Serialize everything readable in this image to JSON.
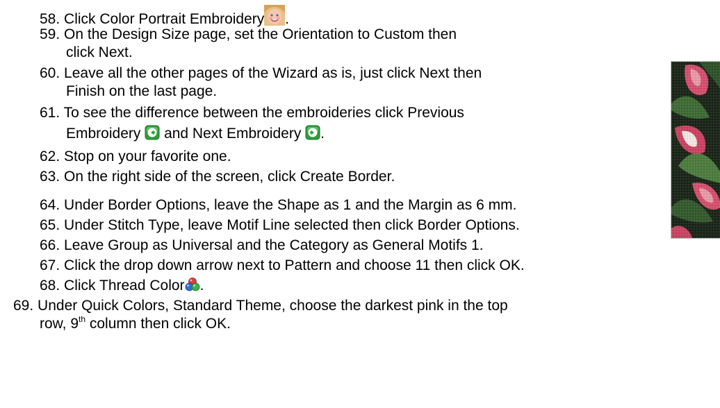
{
  "steps": [
    {
      "num": "58.",
      "pre": "Click Color Portrait Embroidery",
      "post": ".",
      "icon": "child-face-icon"
    },
    {
      "num": "59.",
      "line1": "On the Design Size page, set the Orientation to Custom then",
      "line2": "click Next."
    },
    {
      "num": "60.",
      "line1": "Leave all the other pages of the Wizard as is, just click Next then",
      "line2": "Finish on the last page."
    },
    {
      "num": "61.",
      "line1": "To see the difference between the embroideries click Previous",
      "line2_a": "Embroidery",
      "line2_b": "and Next Embroidery",
      "line2_c": ".",
      "icon_prev": "previous-embroidery-icon",
      "icon_next": "next-embroidery-icon"
    },
    {
      "num": "62.",
      "text": "Stop on your favorite one."
    },
    {
      "num": "63.",
      "text": "On the right side of the screen, click Create Border."
    },
    {
      "num": "64.",
      "text": "Under Border Options, leave the Shape as 1 and the Margin as 6 mm."
    },
    {
      "num": "65.",
      "text": "Under Stitch Type, leave Motif Line selected then click Border Options."
    },
    {
      "num": "66.",
      "text": "Leave Group as Universal and the Category as General Motifs 1."
    },
    {
      "num": "67.",
      "text": "Click the drop down arrow next to Pattern and choose 11 then click OK."
    },
    {
      "num": "68.",
      "pre": "Click Thread Color",
      "post": ".",
      "icon": "thread-color-icon"
    },
    {
      "num": "69.",
      "line1": "Under Quick Colors, Standard Theme, choose the darkest pink in the top",
      "line2_a": "row, 9",
      "line2_sup": "th",
      "line2_b": " column then click OK."
    }
  ],
  "photo": {
    "icon": "embroidery-photo",
    "colors": {
      "bg": "#1b2619",
      "leaf": "#3f6b35",
      "flower": "#d4506e",
      "pink": "#e79aa8",
      "white": "#f2e6e3"
    }
  }
}
